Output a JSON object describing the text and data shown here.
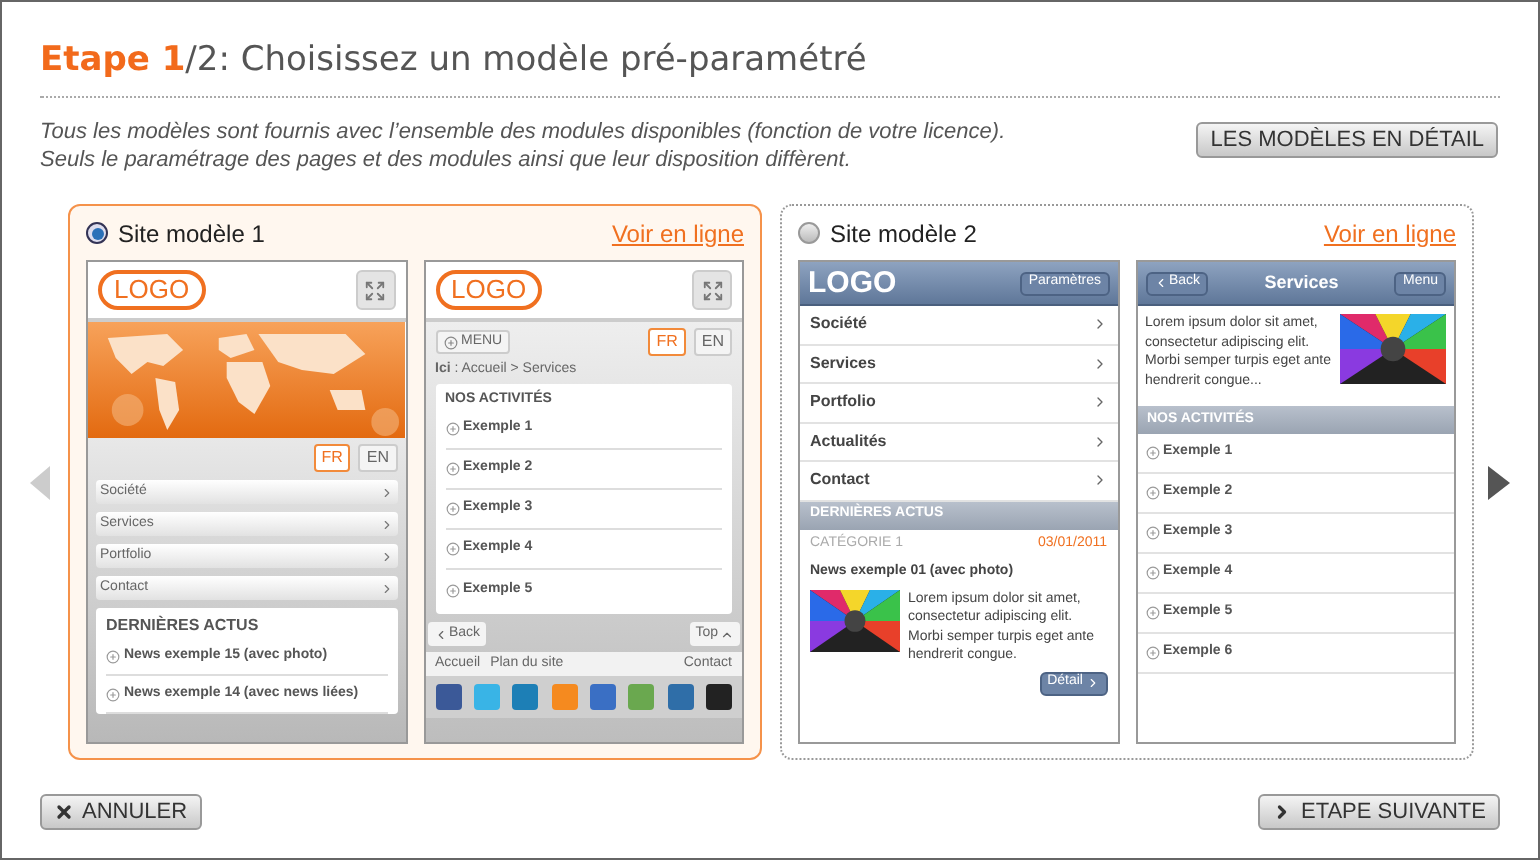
{
  "title": {
    "step": "Etape 1",
    "rest": "/2: Choisissez un modèle pré-paramétré"
  },
  "intro": [
    "Tous les modèles sont fournis avec l’ensemble des modules disponibles (fonction de votre licence).",
    "Seuls le paramétrage des pages et des modules ainsi que leur disposition diffèrent."
  ],
  "details_button": "LES MODÈLES EN DÉTAIL",
  "models": [
    {
      "label": "Site modèle 1",
      "selected": true,
      "link": "Voir en ligne",
      "screens": [
        {
          "kind": "orangeHome",
          "logo": "LOGO",
          "langs": [
            {
              "label": "FR",
              "selected": true
            },
            {
              "label": "EN",
              "selected": false
            }
          ],
          "menu": [
            "Société",
            "Services",
            "Portfolio",
            "Contact"
          ],
          "news_title": "DERNIÈRES ACTUS",
          "news": [
            "News exemple 15 (avec photo)",
            "News exemple 14 (avec news liées)"
          ]
        },
        {
          "kind": "orangeServices",
          "logo": "LOGO",
          "menu_button": "MENU",
          "langs": [
            {
              "label": "FR",
              "selected": true
            },
            {
              "label": "EN",
              "selected": false
            }
          ],
          "breadcrumb": "**Ici** : Accueil > Services",
          "section": "NOS ACTIVITÉS",
          "items": [
            "Exemple 1",
            "Exemple 2",
            "Exemple 3",
            "Exemple 4",
            "Exemple 5"
          ],
          "back": "Back",
          "top": "Top",
          "footer_links": [
            "Accueil",
            "Plan du site"
          ],
          "footer_contact": "Contact"
        }
      ]
    },
    {
      "label": "Site modèle 2",
      "selected": false,
      "link": "Voir en ligne",
      "screens": [
        {
          "kind": "blueHome",
          "logo": "LOGO",
          "settings": "Paramètres",
          "menu": [
            "Société",
            "Services",
            "Portfolio",
            "Actualités",
            "Contact"
          ],
          "news_title": "DERNIÈRES ACTUS",
          "category": "CATÉGORIE 1",
          "date": "03/01/2011",
          "headline": "News exemple 01 (avec photo)",
          "text": "Lorem ipsum dolor sit amet, consectetur adipiscing elit. Morbi semper turpis eget ante hendrerit congue.",
          "detail": "Détail"
        },
        {
          "kind": "blueServices",
          "back": "Back",
          "title": "Services",
          "menu_button": "Menu",
          "text": "Lorem ipsum dolor sit amet, consectetur adipiscing elit. Morbi semper turpis eget ante hendrerit congue...",
          "section": "NOS ACTIVITÉS",
          "items": [
            "Exemple 1",
            "Exemple 2",
            "Exemple 3",
            "Exemple 4",
            "Exemple 5",
            "Exemple 6"
          ]
        }
      ]
    }
  ],
  "buttons": {
    "cancel": "ANNULER",
    "next": "ETAPE SUIVANTE"
  }
}
